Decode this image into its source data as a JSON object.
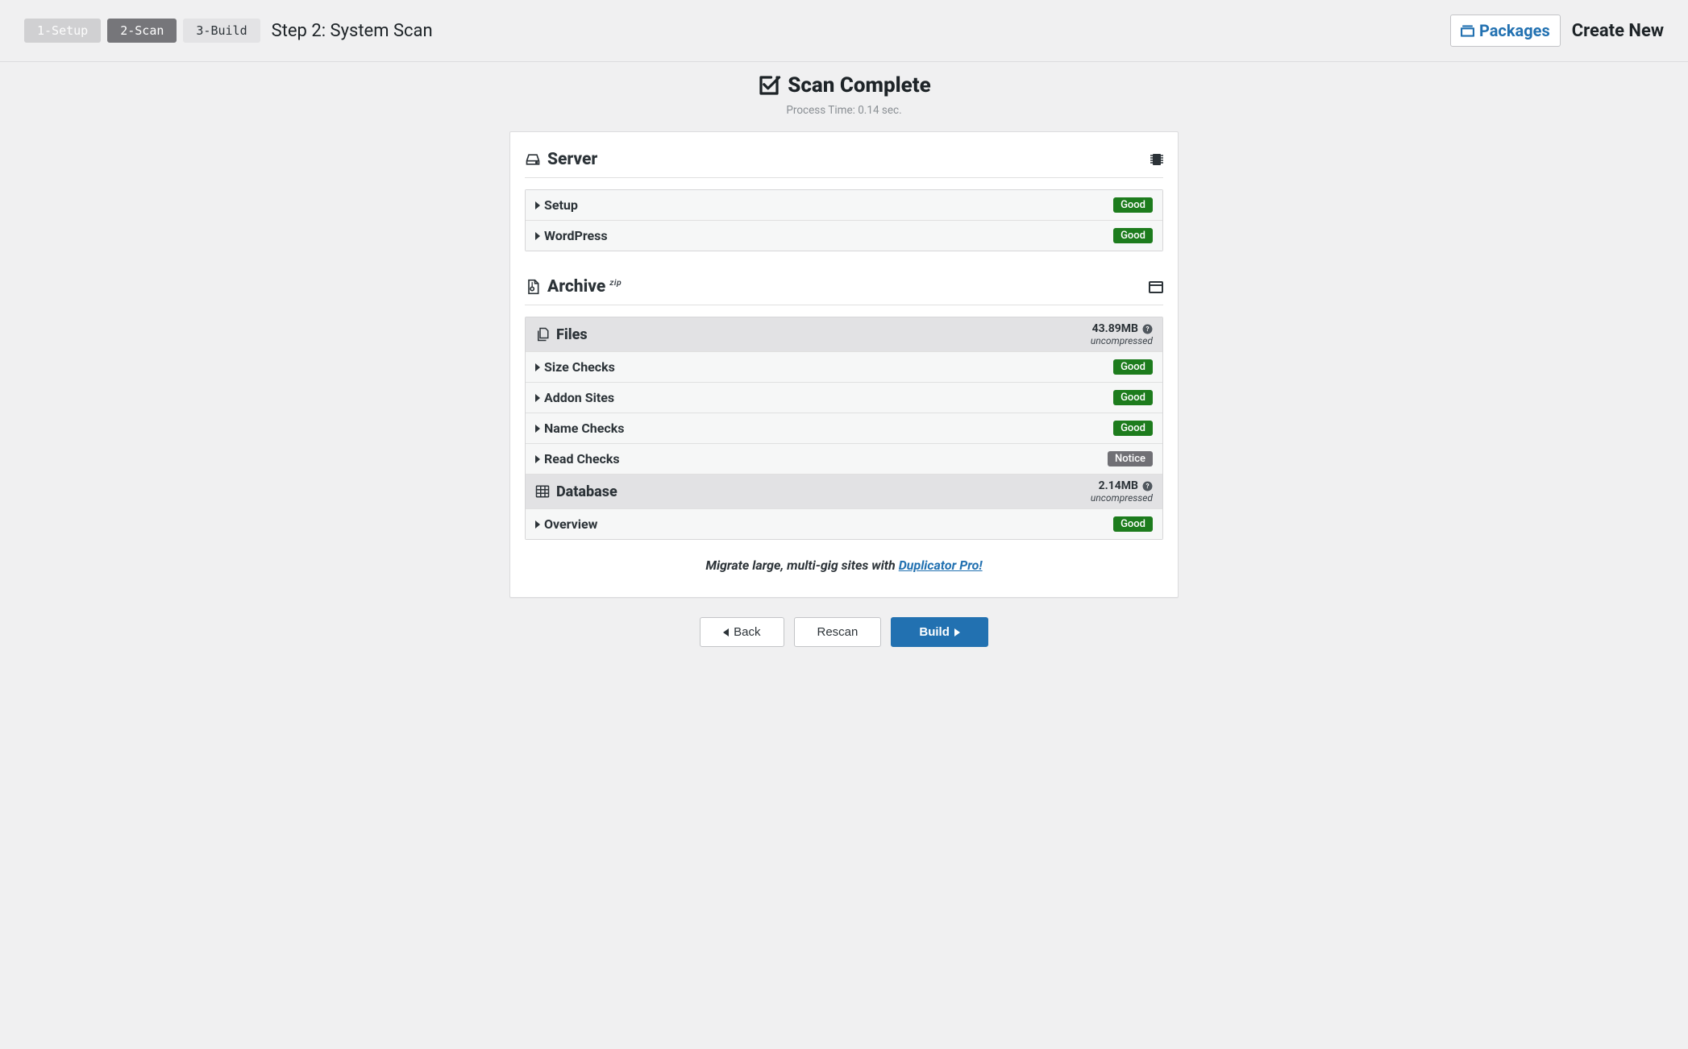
{
  "topbar": {
    "steps": [
      {
        "id": "step1",
        "label": "1-Setup",
        "state": "disabled"
      },
      {
        "id": "step2",
        "label": "2-Scan",
        "state": "active"
      },
      {
        "id": "step3",
        "label": "3-Build",
        "state": "upcoming"
      }
    ],
    "heading": "Step 2: System Scan",
    "packages_label": "Packages",
    "create_new": "Create New"
  },
  "scan_head": {
    "title": "Scan Complete",
    "subtitle": "Process Time: 0.14 sec."
  },
  "sections": {
    "server": {
      "title": "Server",
      "rows": [
        {
          "label": "Setup",
          "status": "Good",
          "status_class": "good"
        },
        {
          "label": "WordPress",
          "status": "Good",
          "status_class": "good"
        }
      ]
    },
    "archive": {
      "title": "Archive",
      "format": "zip",
      "files": {
        "title": "Files",
        "size": "43.89MB",
        "uncompressed": "uncompressed",
        "rows": [
          {
            "label": "Size Checks",
            "status": "Good",
            "status_class": "good"
          },
          {
            "label": "Addon Sites",
            "status": "Good",
            "status_class": "good"
          },
          {
            "label": "Name Checks",
            "status": "Good",
            "status_class": "good"
          },
          {
            "label": "Read Checks",
            "status": "Notice",
            "status_class": "notice"
          }
        ]
      },
      "database": {
        "title": "Database",
        "size": "2.14MB",
        "uncompressed": "uncompressed",
        "rows": [
          {
            "label": "Overview",
            "status": "Good",
            "status_class": "good"
          }
        ]
      }
    }
  },
  "promo": {
    "prefix": "Migrate large, multi-gig sites with ",
    "link_text": "Duplicator Pro!"
  },
  "footer": {
    "back": "Back",
    "rescan": "Rescan",
    "build": "Build"
  }
}
